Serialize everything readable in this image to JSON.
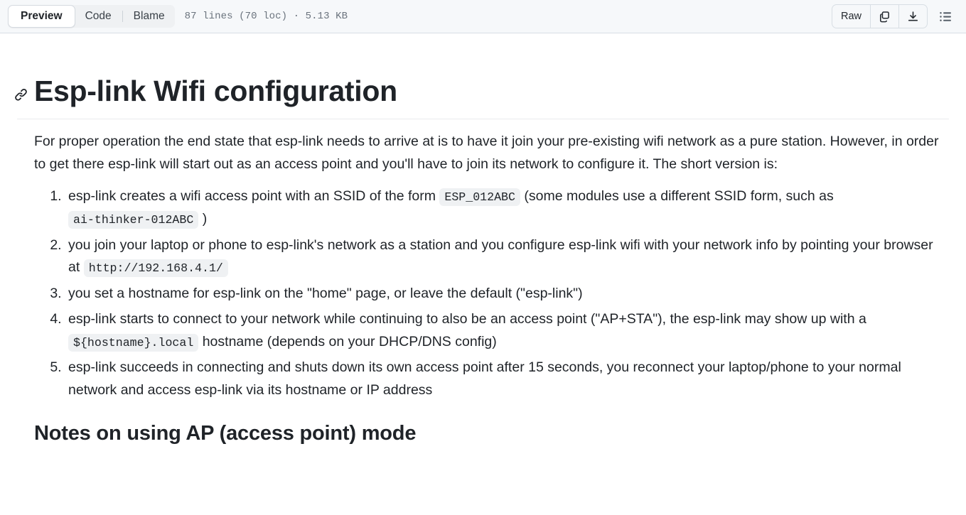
{
  "toolbar": {
    "tabs": [
      {
        "label": "Preview",
        "active": true
      },
      {
        "label": "Code",
        "active": false
      },
      {
        "label": "Blame",
        "active": false
      }
    ],
    "file_meta": "87 lines (70 loc) · 5.13 KB",
    "raw_label": "Raw",
    "copy_icon": "copy-icon",
    "download_icon": "download-icon",
    "outline_icon": "outline-list-icon"
  },
  "document": {
    "anchor_icon": "link-icon",
    "title": "Esp-link Wifi configuration",
    "intro": "For proper operation the end state that esp-link needs to arrive at is to have it join your pre-existing wifi network as a pure station. However, in order to get there esp-link will start out as an access point and you'll have to join its network to configure it. The short version is:",
    "steps": [
      {
        "pre": "esp-link creates a wifi access point with an SSID of the form ",
        "code1": "ESP_012ABC",
        "mid": " (some modules use a different SSID form, such as ",
        "code2": "ai-thinker-012ABC",
        "post": " )"
      },
      {
        "pre": "you join your laptop or phone to esp-link's network as a station and you configure esp-link wifi with your network info by pointing your browser at ",
        "code1": "http://192.168.4.1/",
        "mid": "",
        "code2": "",
        "post": ""
      },
      {
        "pre": "you set a hostname for esp-link on the \"home\" page, or leave the default (\"esp-link\")",
        "code1": "",
        "mid": "",
        "code2": "",
        "post": ""
      },
      {
        "pre": "esp-link starts to connect to your network while continuing to also be an access point (\"AP+STA\"), the esp-link may show up with a ",
        "code1": "${hostname}.local",
        "mid": " hostname (depends on your DHCP/DNS config)",
        "code2": "",
        "post": ""
      },
      {
        "pre": "esp-link succeeds in connecting and shuts down its own access point after 15 seconds, you reconnect your laptop/phone to your normal network and access esp-link via its hostname or IP address",
        "code1": "",
        "mid": "",
        "code2": "",
        "post": ""
      }
    ],
    "section_heading": "Notes on using AP (access point) mode"
  },
  "colors": {
    "toolbar_bg": "#f6f8fa",
    "border": "#d8dee4",
    "text": "#1f2328",
    "muted": "#6a737d",
    "code_bg": "#eff1f3"
  }
}
